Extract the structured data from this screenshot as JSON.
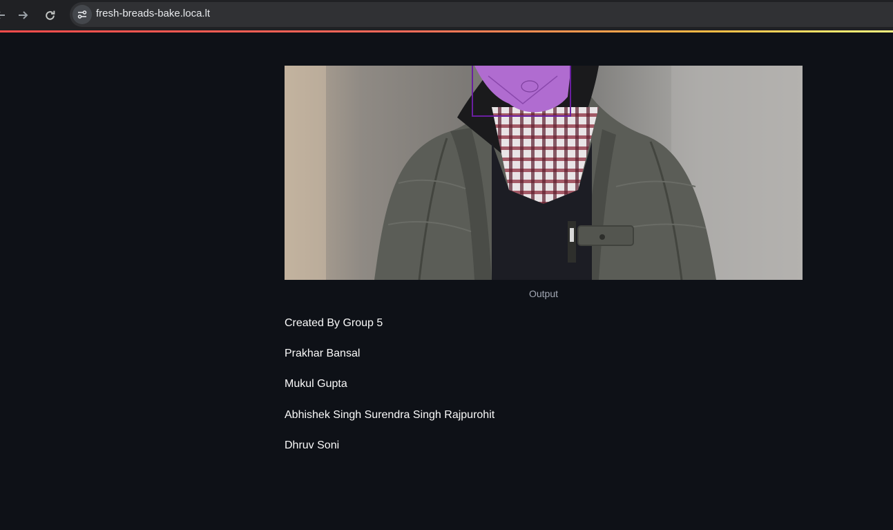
{
  "browser": {
    "url": "fresh-breads-bake.loca.lt",
    "icons": {
      "back": "back-arrow-icon",
      "forward": "forward-arrow-icon",
      "reload": "reload-icon",
      "site_info": "site-settings-icon"
    },
    "colors": {
      "toolbar": "#202124",
      "address_bar": "#303134",
      "loading_bar_start": "#ff4b4b",
      "loading_bar_end": "#fffd80"
    }
  },
  "app": {
    "background": "#0e1117",
    "output_image": {
      "caption": "Output",
      "detection_box_color": "#6a1fa0"
    },
    "credits": {
      "heading": "Created By Group 5",
      "members": [
        "Prakhar Bansal",
        "Mukul Gupta",
        "Abhishek Singh Surendra Singh Rajpurohit",
        "Dhruv Soni"
      ]
    }
  }
}
